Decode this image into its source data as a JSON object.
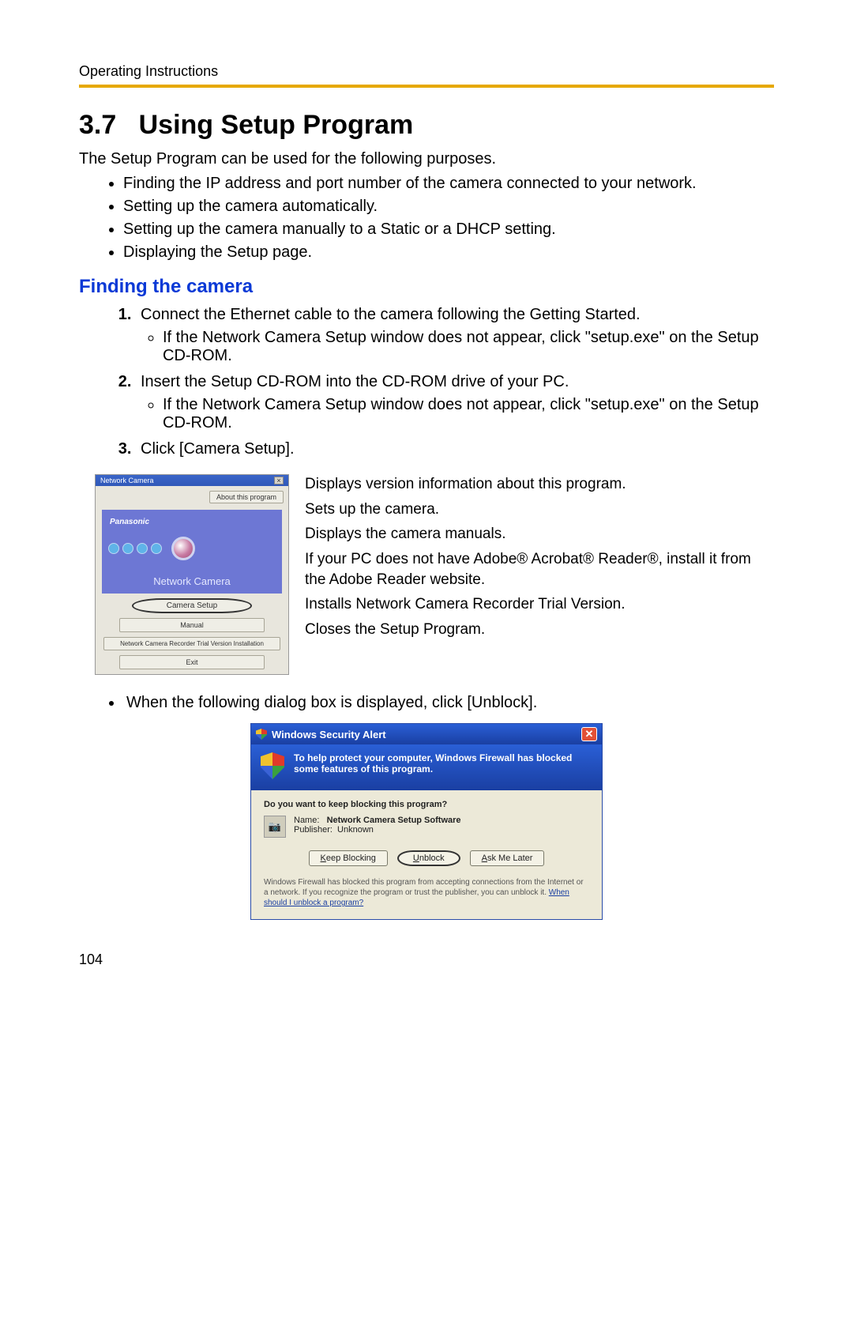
{
  "doc_header": "Operating Instructions",
  "section_number": "3.7",
  "section_title": "Using Setup Program",
  "intro": "The Setup Program can be used for the following purposes.",
  "purposes": [
    "Finding the IP address and port number of the camera connected to your network.",
    "Setting up the camera automatically.",
    "Setting up the camera manually to a Static or a DHCP setting.",
    "Displaying the Setup page."
  ],
  "subheading": "Finding the camera",
  "steps": [
    {
      "text": "Connect the Ethernet cable to the camera following the Getting Started.",
      "sub": [
        "If the Network Camera Setup window does not appear, click \"setup.exe\" on the Setup CD-ROM."
      ]
    },
    {
      "text": "Insert the Setup CD-ROM into the CD-ROM drive of your PC.",
      "sub": [
        "If the Network Camera Setup window does not appear, click \"setup.exe\" on the Setup CD-ROM."
      ]
    },
    {
      "text": "Click [Camera Setup].",
      "sub": []
    }
  ],
  "setup_window": {
    "title": "Network Camera",
    "about_btn": "About this program",
    "brand": "Panasonic",
    "banner_label": "Network Camera",
    "btn_camera_setup": "Camera Setup",
    "btn_manual": "Manual",
    "btn_recorder": "Network Camera Recorder Trial Version Installation",
    "btn_exit": "Exit"
  },
  "callouts": {
    "c1": "Displays version information about this program.",
    "c2": "Sets up the camera.",
    "c3": "Displays the camera manuals.",
    "c4": "If your PC does not have Adobe® Acrobat® Reader®, install it from the Adobe Reader website.",
    "c5": "Installs Network Camera Recorder Trial Version.",
    "c6": "Closes the Setup Program."
  },
  "after_note": "When the following dialog box is displayed, click [Unblock].",
  "xp": {
    "title": "Windows Security Alert",
    "message": "To help protect your computer, Windows Firewall has blocked some features of this program.",
    "question": "Do you want to keep blocking this program?",
    "name_label": "Name:",
    "name_value": "Network Camera Setup Software",
    "pub_label": "Publisher:",
    "pub_value": "Unknown",
    "btn_keep": "Keep Blocking",
    "btn_unblock": "Unblock",
    "btn_ask": "Ask Me Later",
    "footer_a": "Windows Firewall has blocked this program from accepting connections from the Internet or a network. If you recognize the program or trust the publisher, you can unblock it. ",
    "footer_link": "When should I unblock a program?"
  },
  "page_number": "104"
}
